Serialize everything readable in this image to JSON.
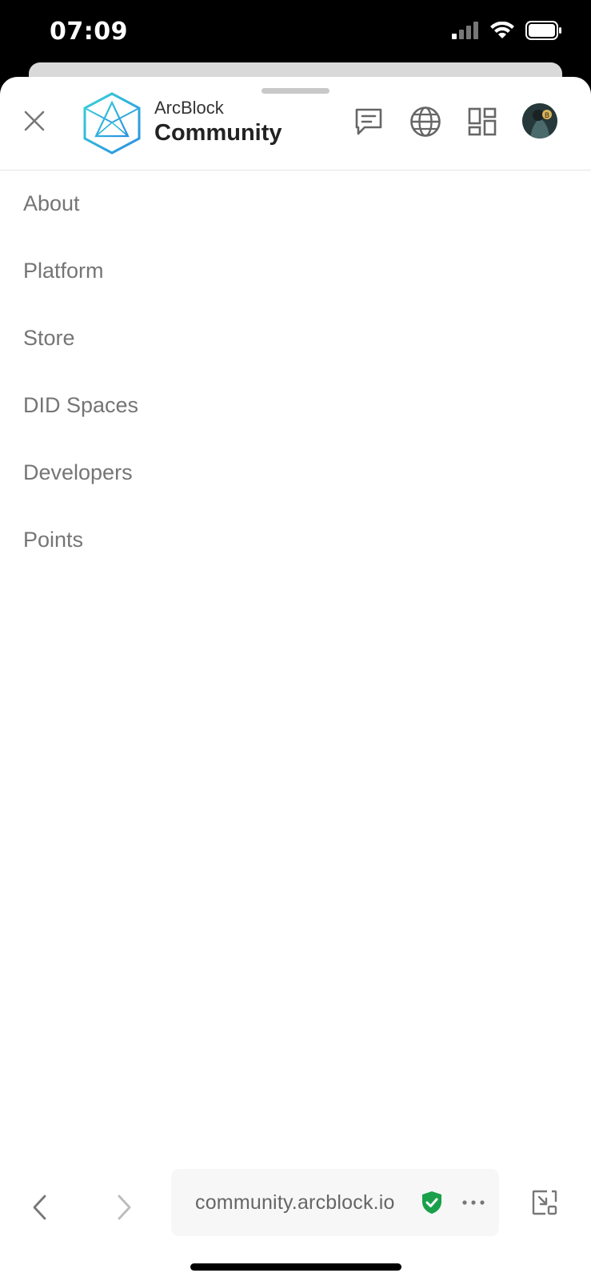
{
  "status_bar": {
    "time": "07:09",
    "icons": [
      "cellular-signal-icon",
      "wifi-icon",
      "battery-icon"
    ]
  },
  "header": {
    "brand_top": "ArcBlock",
    "brand_bottom": "Community",
    "icons": [
      "close-icon",
      "arcblock-logo",
      "chat-icon",
      "globe-icon",
      "apps-grid-icon",
      "avatar"
    ]
  },
  "menu": {
    "items": [
      {
        "label": "About"
      },
      {
        "label": "Platform"
      },
      {
        "label": "Store"
      },
      {
        "label": "DID Spaces"
      },
      {
        "label": "Developers"
      },
      {
        "label": "Points"
      }
    ]
  },
  "browser_bar": {
    "url": "community.arcblock.io",
    "icons": [
      "back-arrow-icon",
      "forward-arrow-icon",
      "secure-shield-icon",
      "more-options-icon",
      "exit-fullscreen-icon"
    ]
  },
  "colors": {
    "accent": "#2bbad0",
    "secure_green": "#1aa04a",
    "menu_text": "#757575"
  }
}
